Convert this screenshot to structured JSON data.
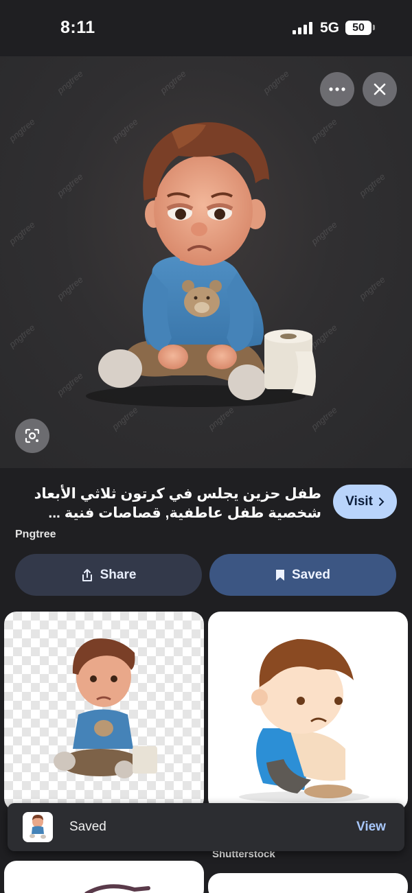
{
  "status_bar": {
    "time": "8:11",
    "network": "5G",
    "battery": "50"
  },
  "hero": {
    "watermark": "pngtree",
    "more_icon": "more-horizontal-icon",
    "close_icon": "close-icon",
    "lens_icon": "google-lens-icon"
  },
  "result": {
    "title": "طفل حزين يجلس في كرتون ثلاثي الأبعاد شخصية طفل عاطفية, قصاصات فنية ...",
    "source": "Pngtree",
    "visit_label": "Visit",
    "share_label": "Share",
    "saved_label": "Saved"
  },
  "grid": {
    "caption_2": "Shutterstock"
  },
  "snackbar": {
    "label": "Saved",
    "action": "View"
  },
  "colors": {
    "background": "#1f1f22",
    "visit_button": "#b9d4fb",
    "share_button": "#33394a",
    "saved_button": "#3c5683",
    "link": "#a8c7fa"
  }
}
